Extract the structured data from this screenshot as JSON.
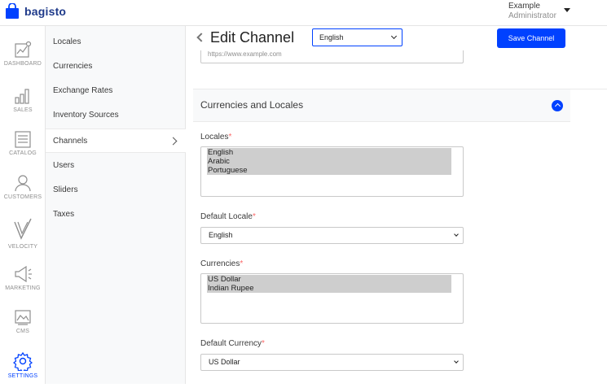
{
  "brand": {
    "name": "bagisto",
    "color": "#1e3a8a"
  },
  "user": {
    "name": "Example",
    "role": "Administrator"
  },
  "nav": {
    "items": [
      {
        "label": "DASHBOARD",
        "icon": "dashboard-chart-icon",
        "active": false
      },
      {
        "label": "SALES",
        "icon": "sales-bar-chart-icon",
        "active": false
      },
      {
        "label": "CATALOG",
        "icon": "catalog-list-icon",
        "active": false
      },
      {
        "label": "CUSTOMERS",
        "icon": "customers-person-icon",
        "active": false
      },
      {
        "label": "VELOCITY",
        "icon": "velocity-check-icon",
        "active": false
      },
      {
        "label": "MARKETING",
        "icon": "marketing-megaphone-icon",
        "active": false
      },
      {
        "label": "CMS",
        "icon": "cms-image-icon",
        "active": false
      },
      {
        "label": "SETTINGS",
        "icon": "settings-gear-icon",
        "active": true
      }
    ]
  },
  "subnav": {
    "items": [
      {
        "label": "Locales"
      },
      {
        "label": "Currencies"
      },
      {
        "label": "Exchange Rates"
      },
      {
        "label": "Inventory Sources"
      },
      {
        "label": "Channels",
        "active": true
      },
      {
        "label": "Users"
      },
      {
        "label": "Sliders"
      },
      {
        "label": "Taxes"
      }
    ]
  },
  "header": {
    "title": "Edit Channel",
    "locale_selected": "English",
    "save_label": "Save Channel"
  },
  "hostname_placeholder": "https://www.example.com",
  "section": {
    "title": "Currencies and Locales",
    "locales_label": "Locales",
    "locales": [
      "English",
      "Arabic",
      "Portuguese"
    ],
    "default_locale_label": "Default Locale",
    "default_locale": "English",
    "currencies_label": "Currencies",
    "currencies": [
      "US Dollar",
      "Indian Rupee"
    ],
    "default_currency_label": "Default Currency",
    "default_currency": "US Dollar"
  },
  "colors": {
    "accent": "#0041ff",
    "required": "#fc6868"
  }
}
